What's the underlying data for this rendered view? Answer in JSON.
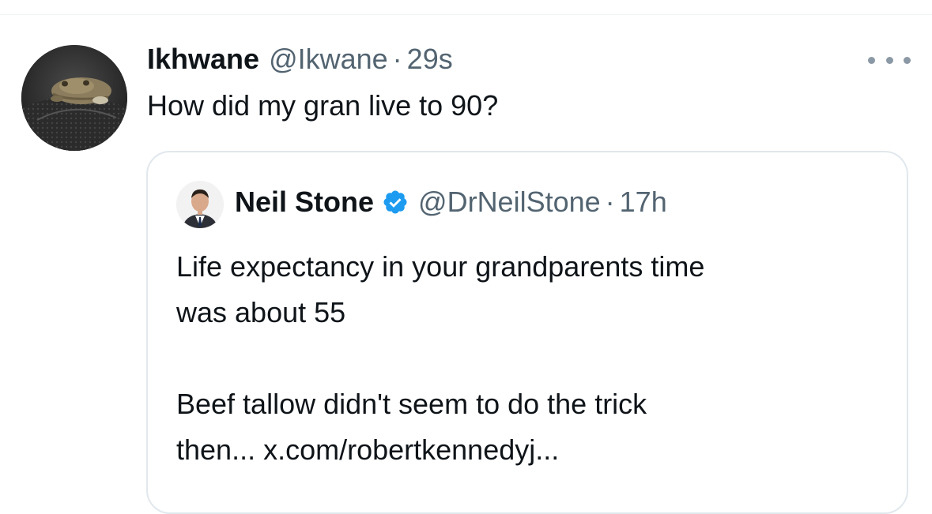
{
  "tweet": {
    "author_name": "Ikhwane",
    "author_handle": "@Ikwane",
    "separator": "·",
    "timestamp": "29s",
    "text": "How did my gran live to 90?",
    "more_icon": "more-horizontal-icon"
  },
  "quote": {
    "author_name": "Neil Stone",
    "verified": true,
    "verified_color": "#1d9bf0",
    "author_handle": "@DrNeilStone",
    "separator": "·",
    "timestamp": "17h",
    "lines": [
      "Life expectancy in your grandparents time",
      "was about 55",
      "",
      "Beef tallow didn't seem to do the trick",
      "then... x.com/robertkennedyj..."
    ]
  },
  "colors": {
    "text_primary": "#0f1419",
    "text_secondary": "#536471",
    "border": "#e1e8ed",
    "accent": "#1d9bf0"
  }
}
